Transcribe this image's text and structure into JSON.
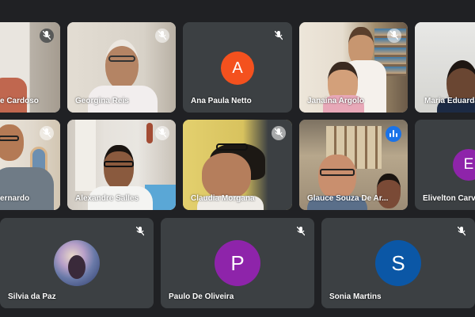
{
  "participants": [
    {
      "name": "e Cardoso",
      "muted": true
    },
    {
      "name": "Georgina Reis",
      "muted": true
    },
    {
      "name": "Ana Paula Netto",
      "muted": true,
      "initial": "A",
      "avatar_color": "#f4511e"
    },
    {
      "name": "Janaina Argolo",
      "muted": true
    },
    {
      "name": "Maria Eduarda",
      "muted": false
    },
    {
      "name": "ernardo",
      "muted": true
    },
    {
      "name": "Alexandre Salles",
      "muted": true
    },
    {
      "name": "Claudia Morgana",
      "muted": true
    },
    {
      "name": "Glauce Souza De Ar...",
      "muted": false,
      "speaking": true
    },
    {
      "name": "Elivelton Carv",
      "muted": false,
      "initial": "E",
      "avatar_color": "#8e24aa"
    },
    {
      "name": "Silvia da Paz",
      "muted": true
    },
    {
      "name": "Paulo De Oliveira",
      "muted": true,
      "initial": "P",
      "avatar_color": "#8e24aa"
    },
    {
      "name": "Sonia Martins",
      "muted": true,
      "initial": "S",
      "avatar_color": "#0b57a6"
    }
  ],
  "icons": {
    "muted": "mic-off-icon",
    "speaking": "audio-level-icon"
  },
  "colors": {
    "background": "#202124",
    "tile": "#3c4043",
    "speaking_badge": "#1a73e8"
  }
}
